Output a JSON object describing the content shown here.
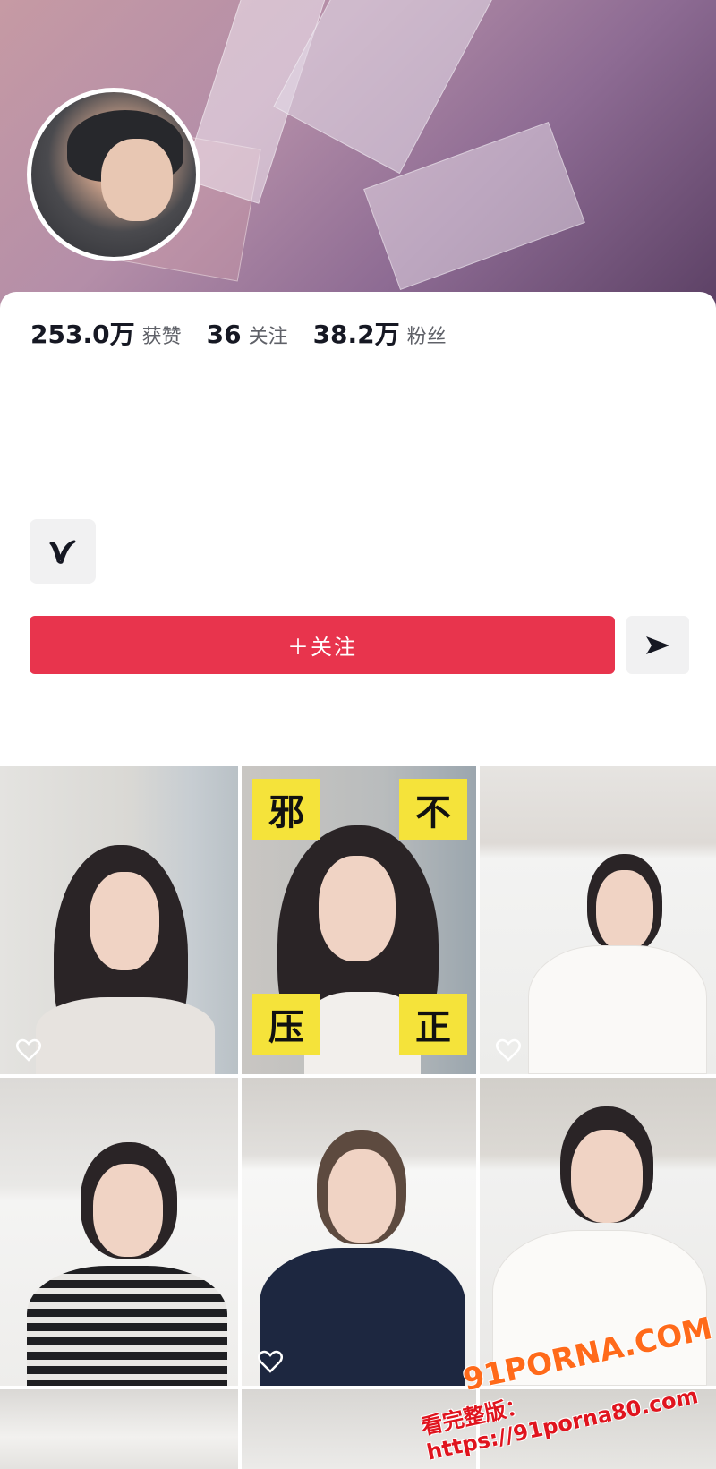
{
  "profile": {
    "stats": [
      {
        "value": "253.0万",
        "label": "获赞"
      },
      {
        "value": "36",
        "label": "关注"
      },
      {
        "value": "38.2万",
        "label": "粉丝"
      }
    ],
    "follow_label": "＋关注",
    "badge_icon": "v-logo-icon",
    "share_icon": "send-arrow-icon"
  },
  "videos": [
    {
      "id": 1,
      "words": []
    },
    {
      "id": 2,
      "words": [
        "邪",
        "不",
        "压",
        "正"
      ]
    },
    {
      "id": 3,
      "words": []
    },
    {
      "id": 4,
      "words": []
    },
    {
      "id": 5,
      "words": []
    },
    {
      "id": 6,
      "words": []
    }
  ],
  "watermark": {
    "brand": "91PORNA.COM",
    "url": "看完整版：https://91porna80.com"
  },
  "colors": {
    "follow_button": "#e8344d",
    "text_primary": "#161823",
    "text_secondary": "#5f6168"
  }
}
